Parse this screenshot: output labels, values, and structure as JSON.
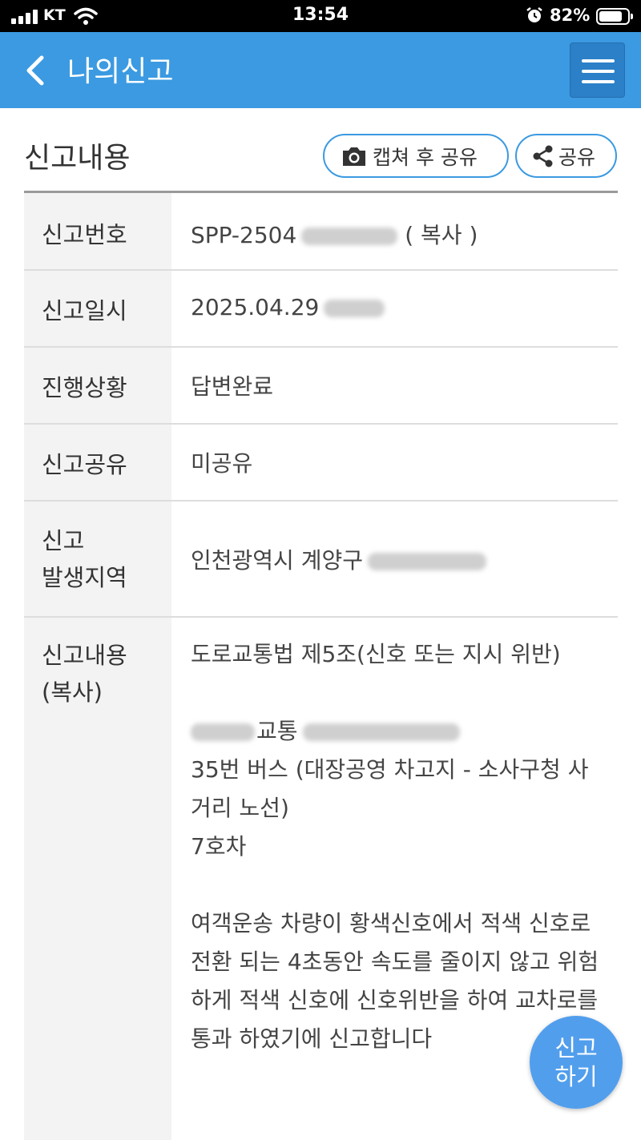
{
  "status_bar": {
    "carrier": "KT",
    "time": "13:54",
    "battery_percent": "82%",
    "battery_level": 0.82
  },
  "header": {
    "title": "나의신고",
    "back_icon": "chevron-left-icon",
    "menu_icon": "hamburger-menu-icon"
  },
  "section": {
    "title": "신고내용",
    "capture_share_label": "캡쳐 후 공유",
    "share_label": "공유"
  },
  "rows": {
    "report_number": {
      "label": "신고번호",
      "value_prefix": "SPP-2504",
      "copy_label": "( 복사 )"
    },
    "report_date": {
      "label": "신고일시",
      "value": "2025.04.29"
    },
    "progress": {
      "label": "진행상황",
      "value": "답변완료"
    },
    "sharing": {
      "label": "신고공유",
      "value": "미공유"
    },
    "area": {
      "label_line1": "신고",
      "label_line2": "발생지역",
      "value": "인천광역시 계양구"
    },
    "content": {
      "label_line1": "신고내용",
      "label_line2": "(복사)",
      "law": "도로교통법 제5조(신호 또는 지시 위반)",
      "company_suffix": "교통",
      "bus_line": "35번 버스 (대장공영 차고지 - 소사구청 사거리 노선)",
      "car_number": "7호차",
      "body": "여객운송 차량이 황색신호에서 적색 신호로 전환 되는 4초동안 속도를 줄이지 않고 위험하게 적색 신호에 신호위반을 하여 교차로를 통과 하였기에 신고합니다"
    }
  },
  "fab": {
    "line1": "신고",
    "line2": "하기"
  },
  "colors": {
    "accent": "#3b9ae1",
    "status_complete": "#4aa8dd"
  }
}
